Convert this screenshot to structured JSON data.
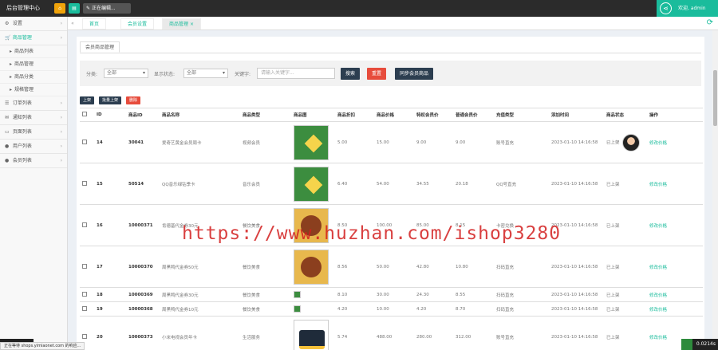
{
  "app": {
    "title": "后台管理中心",
    "edit_label": "正在编辑...",
    "greeting": "欢迎, admin"
  },
  "colors": {
    "accent": "#1abc9c",
    "topbar": "#2b2b2b",
    "danger": "#e74c3c",
    "primary": "#2c3e50"
  },
  "sidebar": {
    "items": [
      {
        "icon": "gear-icon",
        "label": "设置"
      },
      {
        "icon": "cart-icon",
        "label": "商品管理"
      },
      {
        "icon": "list-icon",
        "label": "订单列表"
      },
      {
        "icon": "envelope-icon",
        "label": "通知列表"
      },
      {
        "icon": "monitor-icon",
        "label": "页面列表"
      },
      {
        "icon": "user-icon",
        "label": "用户列表"
      },
      {
        "icon": "user-icon",
        "label": "会员列表"
      }
    ],
    "subitems": [
      "商品列表",
      "商品管理",
      "商品分类",
      "规格管理"
    ]
  },
  "tabs": [
    "首页",
    "会员设置",
    "商品管理"
  ],
  "page": {
    "subtab": "会员商品管理",
    "filter": {
      "category_label": "分类:",
      "category_value": "全部",
      "status_label": "显示状态:",
      "status_value": "全部",
      "keyword_label": "关键字:",
      "keyword_placeholder": "请输入关键字...",
      "search_btn": "搜索",
      "reset_btn": "重置",
      "sync_btn": "同步会员商品"
    },
    "actions": [
      "上架",
      "批量上架",
      "删除"
    ]
  },
  "table": {
    "headers": [
      "",
      "ID",
      "商品ID",
      "商品名称",
      "商品类型",
      "商品图",
      "商品折扣",
      "商品价格",
      "特权会员价",
      "普通会员价",
      "充值类型",
      "添加时间",
      "商品状态",
      "操作"
    ],
    "rows": [
      {
        "id": "14",
        "gid": "30041",
        "name": "爱奇艺黄金会员周卡",
        "type": "视频会员",
        "discount": "5.00",
        "price": "15.00",
        "vip": "9.00",
        "normal": "9.00",
        "charge": "账号直充",
        "time": "2023-01-10 14:16:58",
        "status": "已上架",
        "op": "修改价格"
      },
      {
        "id": "15",
        "gid": "50514",
        "name": "QQ音乐绿钻季卡",
        "type": "音乐会员",
        "discount": "6.40",
        "price": "54.00",
        "vip": "34.55",
        "normal": "20.18",
        "charge": "QQ号直充",
        "time": "2023-01-10 14:16:58",
        "status": "已上架",
        "op": "修改价格"
      },
      {
        "id": "16",
        "gid": "10000371",
        "name": "肯德基代金券30元",
        "type": "餐饮美食",
        "discount": "8.50",
        "price": "100.00",
        "vip": "85.00",
        "normal": "8.15",
        "charge": "卡密兑换",
        "time": "2023-01-10 14:16:58",
        "status": "已上架",
        "op": "修改价格"
      },
      {
        "id": "17",
        "gid": "10000370",
        "name": "周黑鸭代金券50元",
        "type": "餐饮美食",
        "discount": "8.56",
        "price": "50.00",
        "vip": "42.80",
        "normal": "10.80",
        "charge": "扫码直充",
        "time": "2023-01-10 14:16:58",
        "status": "已上架",
        "op": "修改价格"
      },
      {
        "id": "18",
        "gid": "10000369",
        "name": "周黑鸭代金券30元",
        "type": "餐饮美食",
        "discount": "8.10",
        "price": "30.00",
        "vip": "24.30",
        "normal": "8.55",
        "charge": "扫码直充",
        "time": "2023-01-10 14:16:58",
        "status": "已上架",
        "op": "修改价格"
      },
      {
        "id": "19",
        "gid": "10000368",
        "name": "周黑鸭代金券10元",
        "type": "餐饮美食",
        "discount": "4.20",
        "price": "10.00",
        "vip": "4.20",
        "normal": "8.70",
        "charge": "扫码直充",
        "time": "2023-01-10 14:16:58",
        "status": "已上架",
        "op": "修改价格"
      },
      {
        "id": "20",
        "gid": "10000373",
        "name": "小米电视会员年卡",
        "type": "生活服务",
        "discount": "5.74",
        "price": "488.00",
        "vip": "280.00",
        "normal": "312.00",
        "charge": "账号直充",
        "time": "2023-01-10 14:16:58",
        "status": "已上架",
        "op": "修改价格"
      }
    ]
  },
  "overlay": {
    "watermark": "https://www.huzhan.com/ishop3280",
    "status": "正在等待 shops.yimiaonet.com 的响应...",
    "timer": "0.0214s"
  }
}
